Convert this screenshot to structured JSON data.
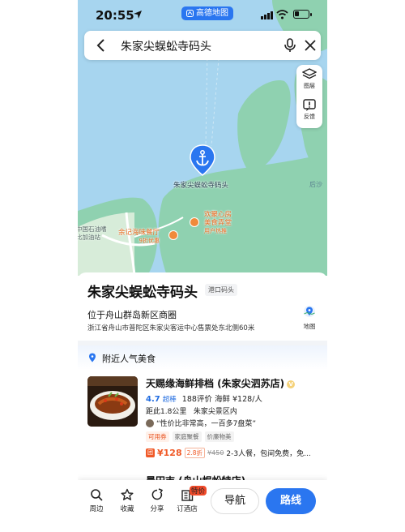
{
  "status_bar": {
    "time": "20:55",
    "app_pill": "高德地图"
  },
  "search": {
    "query": "朱家尖蜈蚣寺码头"
  },
  "map_tools": {
    "layers_label": "图层",
    "feedback_label": "反馈"
  },
  "map_labels": {
    "dock": "朱家尖蜈蚣寺码头",
    "housha": "后沙",
    "sinopec_line1": "中国石油嗜",
    "sinopec_line2": "比加油站",
    "yuji_name": "余记海味餐厅",
    "yuji_sub": "9折优惠",
    "huanju_line1": "欢聚心房",
    "huanju_line2": "美食弄堂",
    "huanju_sub": "用户热推"
  },
  "place": {
    "title": "朱家尖蜈蚣寺码头",
    "tag": "港口码头",
    "address_line1": "位于舟山群岛新区商圈",
    "address_line2": "浙江省舟山市普陀区朱家尖客运中心售票处东北侧60米",
    "map_button": "地图"
  },
  "nearby": {
    "heading": "附近人气美食",
    "restaurant": {
      "name": "天赐缘海鲜排档 (朱家尖泗苏店)",
      "badge": "V",
      "score": "4.7",
      "score_label": "超棒",
      "reviews": "188评价",
      "category": "海鲜",
      "price_per_person": "¥128/人",
      "distance": "距此1.8公里",
      "area": "朱家尖景区内",
      "quote": "“性价比非常高，一百多7盘菜”",
      "tags": [
        "可用券",
        "家庭聚餐",
        "价廉物美"
      ],
      "deal_icon": "团",
      "deal_price": "¥128",
      "deal_discount": "2.8折",
      "deal_original": "¥450",
      "deal_desc": "2-3人餐，包间免费，免..."
    },
    "next_restaurant": "晨田吉 (舟山蜈蚣特店)"
  },
  "toolbar": {
    "nearby": "周边",
    "favorite": "收藏",
    "share": "分享",
    "hotel": "订酒店",
    "hotel_badge": "特价",
    "navigate": "导航",
    "route": "路线"
  },
  "colors": {
    "accent": "#2a76f0",
    "water": "#a7d5ef",
    "land": "#8fd1b0",
    "deal": "#f05a28"
  }
}
